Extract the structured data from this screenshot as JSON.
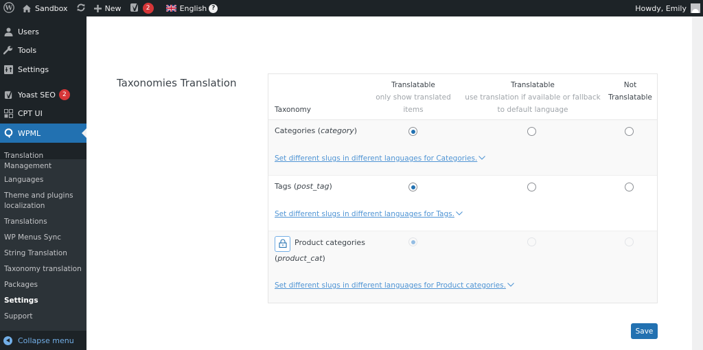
{
  "adminbar": {
    "site_name": "Sandbox",
    "new_label": "New",
    "yoast_badge": "2",
    "language": "English",
    "greeting": "Howdy, Emily"
  },
  "sidebar": {
    "items": [
      {
        "label": "Users",
        "icon": "users-icon"
      },
      {
        "label": "Tools",
        "icon": "wrench-icon"
      },
      {
        "label": "Settings",
        "icon": "settings-icon"
      },
      {
        "label": "Yoast SEO",
        "icon": "yoast-icon",
        "badge": "2"
      },
      {
        "label": "CPT UI",
        "icon": "grid-icon"
      },
      {
        "label": "WPML",
        "icon": "wpml-icon",
        "active": true
      }
    ],
    "submenu": [
      {
        "label": "Translation Management"
      },
      {
        "label": "Languages"
      },
      {
        "label": "Theme and plugins localization"
      },
      {
        "label": "Translations"
      },
      {
        "label": "WP Menus Sync"
      },
      {
        "label": "String Translation"
      },
      {
        "label": "Taxonomy translation"
      },
      {
        "label": "Packages"
      },
      {
        "label": "Settings",
        "current": true
      },
      {
        "label": "Support"
      }
    ],
    "collapse_label": "Collapse menu"
  },
  "main": {
    "section_title": "Taxonomies Translation",
    "table": {
      "headers": {
        "taxonomy": "Taxonomy",
        "col1_title": "Translatable",
        "col1_sub": "only show translated items",
        "col2_title": "Translatable",
        "col2_sub": "use translation if available or fallback to default language",
        "col3_title": "Not Translatable"
      },
      "rows": [
        {
          "name": "Categories",
          "slug": "category",
          "selected": "translatable_only",
          "locked": false,
          "link": "Set different slugs in different languages for Categories."
        },
        {
          "name": "Tags",
          "slug": "post_tag",
          "selected": "translatable_only",
          "locked": false,
          "link": "Set different slugs in different languages for Tags."
        },
        {
          "name": "Product categories",
          "slug": "product_cat",
          "selected": "translatable_only",
          "locked": true,
          "link": "Set different slugs in different languages for Product categories."
        }
      ]
    },
    "save_label": "Save"
  },
  "colors": {
    "accent": "#2271b1",
    "link": "#4f94d4",
    "badge": "#d63638",
    "adminbar": "#1d2327"
  }
}
